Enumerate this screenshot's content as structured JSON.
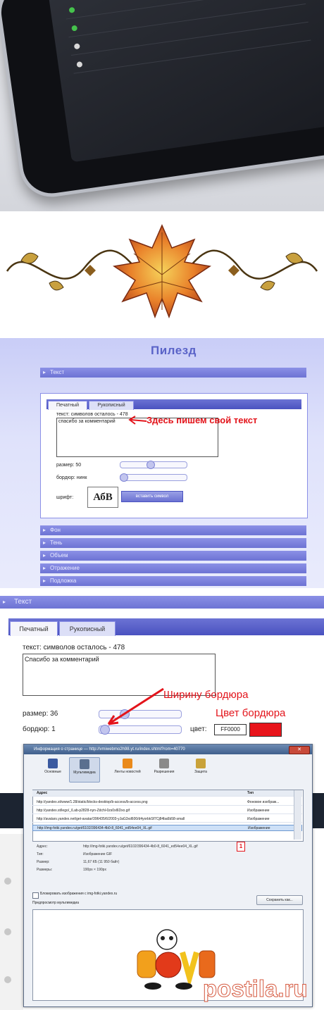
{
  "panel": {
    "title": "Пилезд",
    "text_section": "Текст",
    "tabs": [
      "Печатный",
      "Рукописный"
    ],
    "chars_left": "текст: символов осталось - 478",
    "textarea_value": "спасибо за комментарий",
    "size_label": "размер: 50",
    "border_label": "бордюр: нинк",
    "font_label": "шрифт:",
    "font_preview": "АбВ",
    "insert_symbol_button": "вставить символ",
    "annotation": "Здесь пишем свой текст",
    "sections": [
      "Фон",
      "Тень",
      "Объем",
      "Отражение",
      "Подложка"
    ]
  },
  "panel2": {
    "text_section": "Текст",
    "tabs": [
      "Печатный",
      "Рукописный"
    ],
    "chars_left": "текст: символов осталось - 478",
    "textarea_value": "Спасибо за комментарий",
    "size_label": "размер: 36",
    "border_label": "бордюр: 1",
    "color_label": "цвет:",
    "color_value": "FF0000",
    "annotation_width": "Ширину бордюра",
    "annotation_color": "Цвет бордюра",
    "border_color": "#e8141b"
  },
  "page_info": {
    "window_title": "Информация о странице — http://vmiwebmo2h98.yt.ru/index.shtml?rom=40770",
    "toolbar": [
      "Основные",
      "Мультимедиа",
      "Ленты новостей",
      "Разрешения",
      "Защита"
    ],
    "columns": [
      "Адрес",
      "Тип"
    ],
    "rows": [
      {
        "address": "http://yandex.st/www/1.28/static/blocks-desktop/b-access/b-access.png",
        "type": "Фоновое изображ..."
      },
      {
        "address": "http://yandex.st/lego/_/Lab-p2828-nyn-Zdchl-0zs0xl6Dxo.gif",
        "type": "Изображение"
      },
      {
        "address": "http://avatars.yandex.net/get-avatar/396435/6/2003-yJaG3xd600/d4yorbkSf7Cj84ba6b58-small",
        "type": "Изображение"
      },
      {
        "address": "http://img-fotki.yandex.ru/get/6102/396434-4b0-8_6041_ed54ee04_XL.gif",
        "type": "Изображение"
      }
    ],
    "details": [
      {
        "key": "Адрес:",
        "value": "http://img-fotki.yandex.ru/get/6102/396434-4b0-8_6041_ed54ee04_XL.gif"
      },
      {
        "key": "Тип:",
        "value": "Изображение GIF"
      },
      {
        "key": "Размер:",
        "value": "11,67 КБ (11 950 байт)"
      },
      {
        "key": "Размеры:",
        "value": "190px × 190px"
      }
    ],
    "block_checkbox": "Блокировать изображения с img-fotki.yandex.ru",
    "save_button": "Сохранить как...",
    "preview_label": "Предпросмотр мультимедиа",
    "marker": "1"
  },
  "colors": {
    "accent": "#6d73d4",
    "annotation_red": "#e3141b"
  }
}
